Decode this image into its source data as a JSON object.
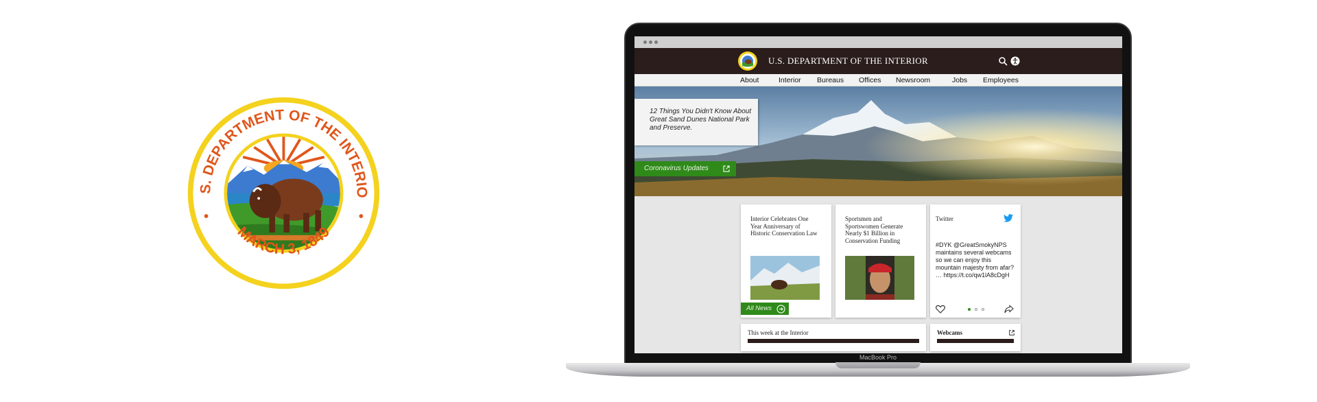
{
  "seal": {
    "top_text": "U.S. DEPARTMENT OF THE INTERIOR",
    "bottom_text": "MARCH 3, 1849"
  },
  "device": {
    "label": "MacBook Pro"
  },
  "site": {
    "title": "U.S. DEPARTMENT OF THE INTERIOR",
    "icons": {
      "search": "search-icon",
      "accessibility": "accessibility-icon"
    },
    "nav": [
      "About",
      "Interior",
      "Bureaus",
      "Offices",
      "Newsroom",
      "Jobs",
      "Employees"
    ]
  },
  "hero": {
    "headline": "12 Things You Didn't Know About Great Sand Dunes National Park and Preserve.",
    "covid_button": "Coronavirus Updates"
  },
  "cards": {
    "news1": {
      "title": "Interior Celebrates One Year Anniversary of Historic Conservation Law"
    },
    "news2": {
      "title": "Sportsmen and Sportswomen Generate Nearly $1 Billion in Conservation Funding"
    },
    "all_news": "All News",
    "twitter": {
      "title": "Twitter",
      "text": "#DYK @GreatSmokyNPS maintains several webcams so we can enjoy this mountain majesty from afar? … https://t.co/qw1lA8cDgH",
      "carousel_active": 0
    },
    "week": {
      "title": "This week at the Interior"
    },
    "webcams": {
      "title": "Webcams"
    }
  },
  "colors": {
    "header_bg": "#2a1d1b",
    "accent_green": "#2f8a1a",
    "twitter_blue": "#1d9bf0",
    "seal_orange": "#e0561b",
    "seal_yellow": "#f4d21e"
  }
}
